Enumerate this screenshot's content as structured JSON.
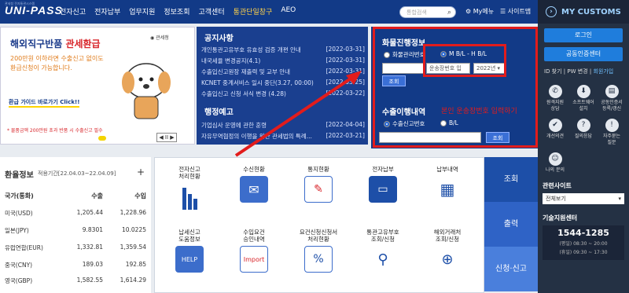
{
  "topbar": {
    "logo": "UNI-PASS",
    "logo_sub": "관세청 전자통관시스템",
    "nav": [
      "전자신고",
      "전자납부",
      "업무지원",
      "정보조회",
      "고객센터",
      "통관단일창구",
      "AEO"
    ],
    "search_placeholder": "통합검색",
    "mymenu": "My메뉴",
    "sitemap": "사이트맵"
  },
  "right_panel": {
    "title": "MY CUSTOMS",
    "login": "로그인",
    "cert": "공동인증센터",
    "links": [
      "ID 찾기",
      "PW 변경",
      "회원가입"
    ],
    "icons": [
      {
        "label": "원격지원\n상담",
        "icon": "remote-support-icon"
      },
      {
        "label": "소프트웨어\n설치",
        "icon": "software-icon"
      },
      {
        "label": "공동인증서\n등록/갱신",
        "icon": "certificate-icon"
      },
      {
        "label": "개선의견",
        "icon": "feedback-icon"
      },
      {
        "label": "질의응답",
        "icon": "qna-icon"
      },
      {
        "label": "자주묻는\n질문",
        "icon": "faq-icon"
      },
      {
        "label": "나의 문의",
        "icon": "my-inquiry-icon"
      }
    ],
    "related_sites": "관련사이트",
    "related_select": "전체보기",
    "help_title": "기술지원센터",
    "phone": "1544-1285",
    "hours1": "(평일) 08:30 ~ 20:00",
    "hours2": "(휴일) 09:30 ~ 17:30"
  },
  "banner": {
    "headline": "해외직구반품",
    "headline_red": "관세환급",
    "line1": "200만원 이하라면 수출신고 없이도",
    "line2": "환급신청이 가능합니다.",
    "guide": "환급 가이드 바로가기 Click!!",
    "note": "* 물품금액 200만원 초과 반품 시 수출신고 필수",
    "agency": "관세청",
    "controls": "◀ II ▶"
  },
  "notices": {
    "title": "공지사항",
    "items": [
      {
        "text": "개인통관고유부호 유효성 검증 개편 안내",
        "date": "[2022-03-31]"
      },
      {
        "text": "내국세율 변경공지(4.1)",
        "date": "[2022-03-31]"
      },
      {
        "text": "수출입신고원장 재출력 및 교부 안내",
        "date": "[2022-03-31]"
      },
      {
        "text": "KCNET 중계서비스 일시 중단(3.27, 00:00)",
        "date": "[2022-03-25]"
      },
      {
        "text": "수출입신고 신청 서식 변경 (4.28)",
        "date": "[2022-03-22]"
      }
    ]
  },
  "admin_notices": {
    "title": "행정예고",
    "items": [
      {
        "text": "기업심사 운영에 관한 훈령",
        "date": "[2022-04-04]"
      },
      {
        "text": "자유무역협정의 이행을 위한 관세법의 특례...",
        "date": "[2022-03-21]"
      }
    ]
  },
  "cargo": {
    "title": "화물진행정보",
    "radio1": "화물관리번호",
    "radio2": "M B/L - H B/L",
    "bl_input_placeholder": "운송장번호 입",
    "year": "2022년",
    "search_btn": "조회",
    "export_title": "수출이행내역",
    "exp_radio1": "수출신고번호",
    "exp_radio2": "B/L",
    "annotation": "본인 운송장번호 입력하기"
  },
  "fx": {
    "title": "환율정보",
    "period": "적용기간[22.04.03~22.04.09]",
    "headers": [
      "국가(통화)",
      "수출",
      "수입"
    ],
    "rows": [
      [
        "미국(USD)",
        "1,205.44",
        "1,228.96"
      ],
      [
        "일본(JPY)",
        "9.8301",
        "10.0225"
      ],
      [
        "유럽연합(EUR)",
        "1,332.81",
        "1,359.54"
      ],
      [
        "중국(CNY)",
        "189.03",
        "192.85"
      ],
      [
        "영국(GBP)",
        "1,582.55",
        "1,614.29"
      ]
    ]
  },
  "services": [
    {
      "label": "전자신고\n처리현황",
      "icon": "bar-chart-icon"
    },
    {
      "label": "수신현황",
      "icon": "mail-icon"
    },
    {
      "label": "통지현황",
      "icon": "notice-icon"
    },
    {
      "label": "전자납부",
      "icon": "payment-icon"
    },
    {
      "label": "납부내역",
      "icon": "receipt-icon"
    },
    {
      "label": "납세신고\n도움정보",
      "icon": "help-book-icon"
    },
    {
      "label": "수입요건\n승인내역",
      "icon": "import-icon"
    },
    {
      "label": "요건신청신청서\n처리현황",
      "icon": "percent-doc-icon"
    },
    {
      "label": "통관고유부호\n조회/신청",
      "icon": "person-search-icon"
    },
    {
      "label": "해외거래처\n조회/신청",
      "icon": "global-search-icon"
    }
  ],
  "side_tabs": [
    "조회",
    "출력",
    "신청·신고"
  ],
  "colors": {
    "navy": "#123a87",
    "red_annotation": "#e21c1c",
    "accent": "#1f7ddc"
  }
}
